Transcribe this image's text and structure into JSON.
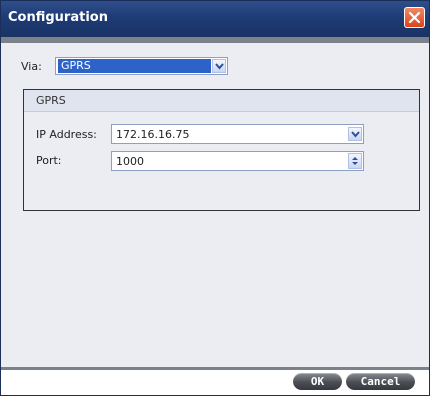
{
  "window": {
    "title": "Configuration"
  },
  "via": {
    "label": "Via:",
    "selected": "GPRS"
  },
  "panel": {
    "title": "GPRS",
    "ip_label": "IP Address:",
    "ip_value": "172.16.16.75",
    "port_label": "Port:",
    "port_value": "1000"
  },
  "footer": {
    "ok_label": "OK",
    "cancel_label": "Cancel"
  },
  "icons": {
    "close": "close-icon",
    "dropdown": "chevron-down-icon",
    "spinner": "spinner-arrows-icon"
  },
  "colors": {
    "titlebar": "#1e3b75",
    "selection": "#2d63c8",
    "close": "#d9431b",
    "button": "#4a4e54"
  }
}
